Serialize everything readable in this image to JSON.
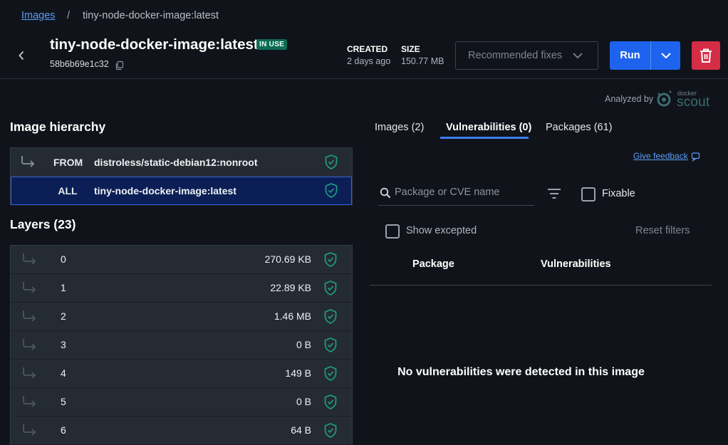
{
  "breadcrumb": {
    "link": "Images",
    "separator": "/",
    "current": "tiny-node-docker-image:latest"
  },
  "header": {
    "title": "tiny-node-docker-image:latest",
    "badge": "IN USE",
    "digest": "58b6b69e1c32",
    "created_label": "CREATED",
    "created_value": "2 days ago",
    "size_label": "SIZE",
    "size_value": "150.77 MB",
    "recommended_fixes": "Recommended fixes",
    "run": "Run"
  },
  "scout": {
    "analyzed_by": "Analyzed by",
    "docker": "docker",
    "scout": "scout"
  },
  "hierarchy": {
    "title": "Image hierarchy",
    "rows": [
      {
        "kind": "FROM",
        "name": "distroless/static-debian12:nonroot"
      },
      {
        "kind": "ALL",
        "name": "tiny-node-docker-image:latest"
      }
    ]
  },
  "layers": {
    "title": "Layers (23)",
    "rows": [
      {
        "index": "0",
        "size": "270.69 KB"
      },
      {
        "index": "1",
        "size": "22.89 KB"
      },
      {
        "index": "2",
        "size": "1.46 MB"
      },
      {
        "index": "3",
        "size": "0 B"
      },
      {
        "index": "4",
        "size": "149 B"
      },
      {
        "index": "5",
        "size": "0 B"
      },
      {
        "index": "6",
        "size": "64 B"
      }
    ]
  },
  "tabs": [
    {
      "label": "Images (2)"
    },
    {
      "label": "Vulnerabilities (0)"
    },
    {
      "label": "Packages (61)"
    }
  ],
  "vuln": {
    "give_feedback": "Give feedback",
    "search_placeholder": "Package or CVE name",
    "fixable": "Fixable",
    "show_excepted": "Show excepted",
    "reset_filters": "Reset filters",
    "col_package": "Package",
    "col_vulnerabilities": "Vulnerabilities",
    "empty_message": "No vulnerabilities were detected in this image"
  },
  "colors": {
    "background": "#10141a",
    "accent": "#1d63ed",
    "danger": "#d52d46",
    "badge": "#0e6b55",
    "shield": "#1ea284"
  }
}
